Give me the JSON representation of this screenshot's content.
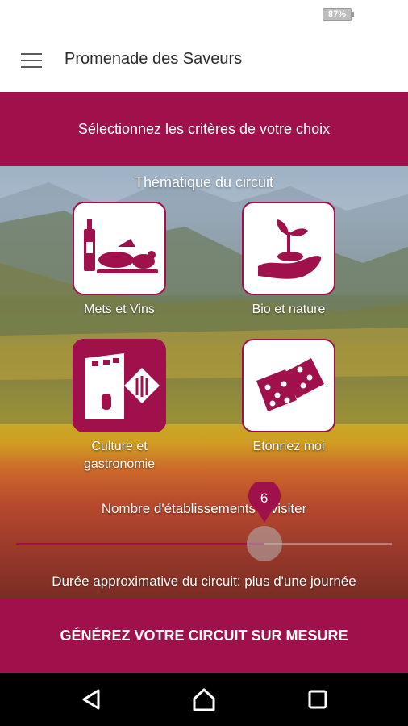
{
  "status_bar": {
    "battery_text": "87%"
  },
  "app_bar": {
    "title": "Promenade des Saveurs",
    "menu_icon": "hamburger-menu-icon"
  },
  "criteria": {
    "header": "Sélectionnez les critères de votre choix"
  },
  "theme": {
    "title": "Thématique du circuit",
    "tiles": [
      {
        "label": "Mets et Vins",
        "icon": "wine-food-icon",
        "selected": false
      },
      {
        "label": "Bio et nature",
        "icon": "plant-in-hand-icon",
        "selected": false
      },
      {
        "label": "Culture et gastronomie",
        "icon": "tower-cutlery-icon",
        "selected": true
      },
      {
        "label": "Etonnez moi",
        "icon": "dice-icon",
        "selected": false
      }
    ]
  },
  "slider": {
    "label": "Nombre d'établissements à visiter",
    "value": "6",
    "fraction": 0.66
  },
  "duration_text": "Durée approximative du circuit: plus d'une journée",
  "generate_button": "GÉNÉREZ VOTRE CIRCUIT SUR MESURE",
  "colors": {
    "brand": "#a0104a",
    "white": "#ffffff",
    "nav_bar": "#000000"
  },
  "nav": {
    "back_icon": "back-icon",
    "home_icon": "home-icon",
    "recents_icon": "recents-icon"
  }
}
